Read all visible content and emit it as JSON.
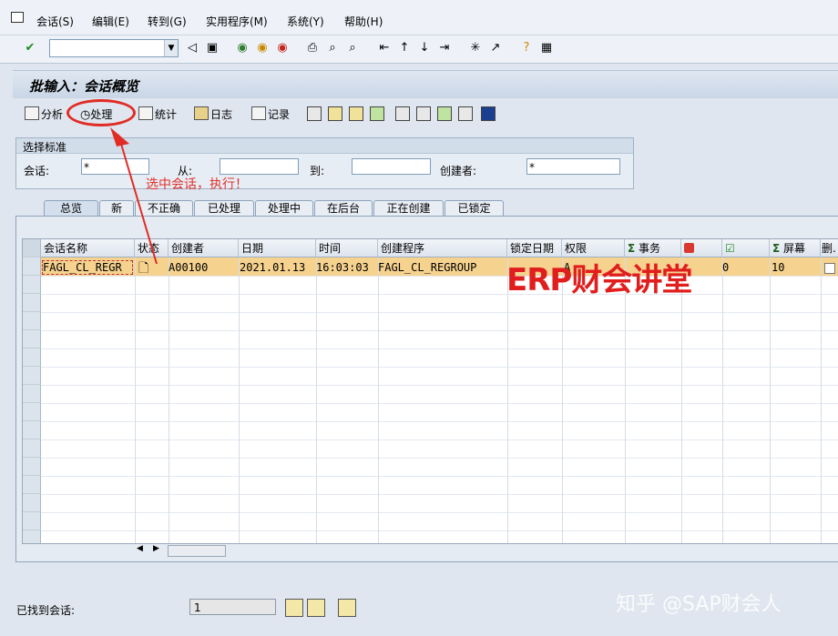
{
  "menu": {
    "items": [
      "会话(S)",
      "编辑(E)",
      "转到(G)",
      "实用程序(M)",
      "系统(Y)",
      "帮助(H)"
    ]
  },
  "toolbar": {
    "command_value": "",
    "icons": [
      "enter-icon",
      "back-icon",
      "save-icon",
      "green-back-icon",
      "exit-icon",
      "cancel-icon",
      "print-icon",
      "find-icon",
      "find-next-icon",
      "first-page-icon",
      "prev-page-icon",
      "next-page-icon",
      "last-page-icon",
      "new-session-icon",
      "shortcut-icon",
      "help-icon",
      "layout-icon"
    ]
  },
  "screen": {
    "title": "批输入：会话概览"
  },
  "app_toolbar": {
    "analyze": "分析",
    "process": "处理",
    "statistics": "统计",
    "log": "日志",
    "record": "记录"
  },
  "selection": {
    "header": "选择标准",
    "session_label": "会话:",
    "session_value": "*",
    "from_label": "从:",
    "from_value": "",
    "to_label": "到:",
    "to_value": "",
    "creator_label": "创建者:",
    "creator_value": "*"
  },
  "tabs": [
    "总览",
    "新",
    "不正确",
    "已处理",
    "处理中",
    "在后台",
    "正在创建",
    "已锁定"
  ],
  "table": {
    "columns": [
      "会话名称",
      "状态",
      "创建者",
      "日期",
      "时间",
      "创建程序",
      "锁定日期",
      "权限",
      "事务",
      "",
      "",
      "屏幕",
      "删."
    ],
    "rows": [
      {
        "session_name": "FAGL_CL_REGR",
        "status_icon": "document-icon",
        "creator": "A00100",
        "date": "2021.01.13",
        "time": "16:03:03",
        "program": "FAGL_CL_REGROUP",
        "lock_date": "",
        "authority": "A",
        "transactions": "",
        "errors": "",
        "processed": "0",
        "screens": "10"
      }
    ]
  },
  "status": {
    "found_label": "已找到会话:",
    "found_value": "1"
  },
  "annotations": {
    "hint": "选中会话，执行！",
    "watermark_red": "ERP财会讲堂",
    "watermark_corner": "知乎 @SAP财会人"
  },
  "colors": {
    "highlight_row": "#f6d28f",
    "annotation_red": "#e0312a",
    "background": "#dfe6ef"
  }
}
